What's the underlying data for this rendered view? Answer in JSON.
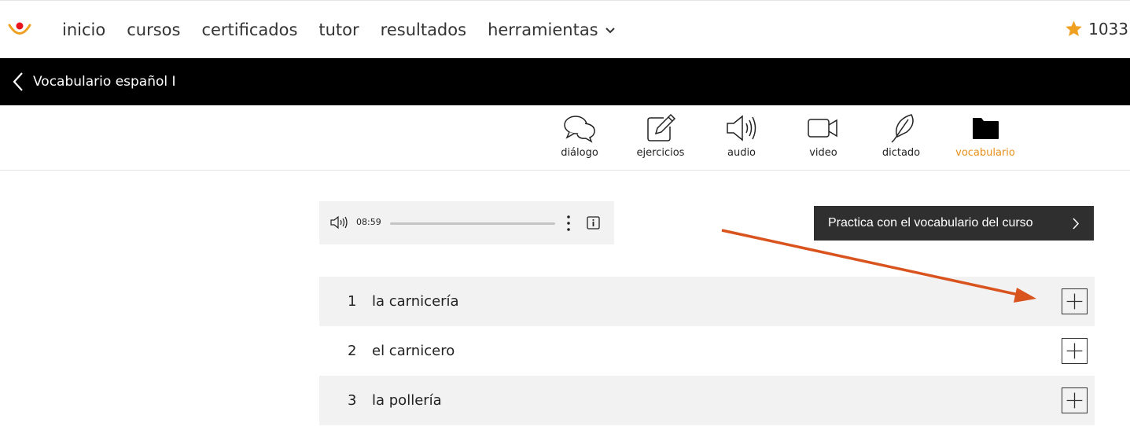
{
  "nav": {
    "items": [
      {
        "label": "inicio"
      },
      {
        "label": "cursos"
      },
      {
        "label": "certificados"
      },
      {
        "label": "tutor"
      },
      {
        "label": "resultados"
      },
      {
        "label": "herramientas"
      }
    ],
    "score": "1033"
  },
  "course": {
    "title": "Vocabulario español I"
  },
  "tabs": [
    {
      "label": "diálogo",
      "icon": "speech-bubbles-icon"
    },
    {
      "label": "ejercicios",
      "icon": "pencil-square-icon"
    },
    {
      "label": "audio",
      "icon": "speaker-icon"
    },
    {
      "label": "video",
      "icon": "video-camera-icon"
    },
    {
      "label": "dictado",
      "icon": "quill-icon"
    },
    {
      "label": "vocabulario",
      "icon": "folder-icon",
      "active": true
    }
  ],
  "player": {
    "time": "08:59"
  },
  "practice_button": {
    "label": "Practica con el vocabulario del curso"
  },
  "vocabulary": [
    {
      "number": "1",
      "word": "la carnicería"
    },
    {
      "number": "2",
      "word": "el carnicero"
    },
    {
      "number": "3",
      "word": "la pollería"
    }
  ],
  "colors": {
    "accent": "#e8901a",
    "annotation_arrow": "#d9531e",
    "course_bar": "#000000",
    "button_dark": "#2f2f2f"
  }
}
